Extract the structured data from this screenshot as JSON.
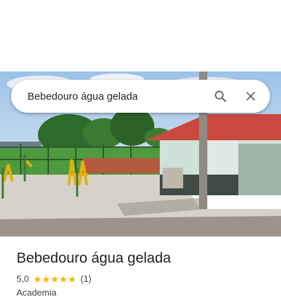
{
  "search": {
    "query": "Bebedouro água gelada",
    "search_icon": "search-icon",
    "close_icon": "close-icon"
  },
  "photo": {
    "icon": "street-view-photo"
  },
  "place": {
    "name": "Bebedouro água gelada",
    "rating": "5,0",
    "stars": [
      "★",
      "★",
      "★",
      "★",
      "★"
    ],
    "review_count": "(1)",
    "category": "Academia"
  },
  "colors": {
    "star": "#f4b400",
    "roof": "#c9483f",
    "sky": "#8fb8e0",
    "grass": "#4e9a3f",
    "pavement": "#d7d2c9",
    "text": "#202124"
  }
}
